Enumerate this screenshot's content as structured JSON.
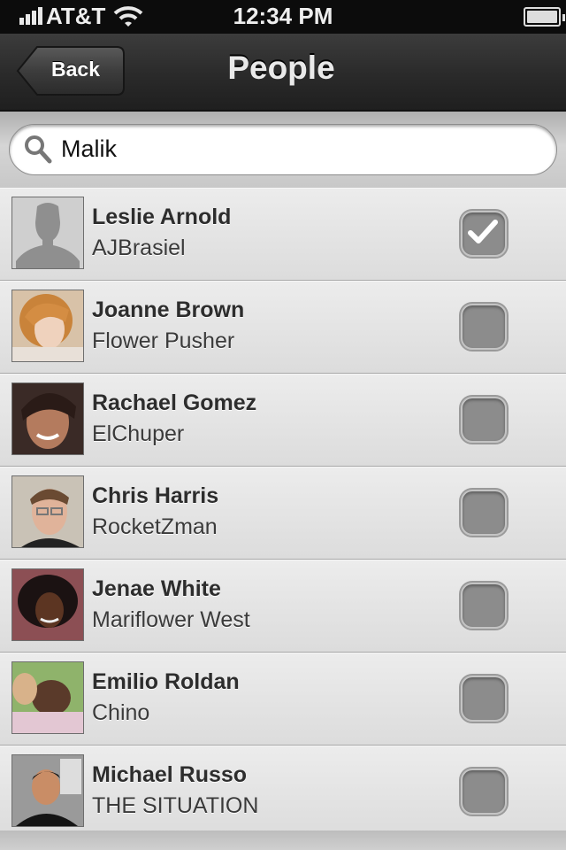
{
  "status_bar": {
    "carrier": "AT&T",
    "time": "12:34 PM"
  },
  "nav": {
    "back_label": "Back",
    "title": "People"
  },
  "search": {
    "value": "Malik"
  },
  "people": [
    {
      "name": "Leslie Arnold",
      "handle": "AJBrasiel",
      "checked": true,
      "avatar": "placeholder"
    },
    {
      "name": "Joanne Brown",
      "handle": "Flower Pusher",
      "checked": false,
      "avatar": "photo"
    },
    {
      "name": "Rachael Gomez",
      "handle": "ElChuper",
      "checked": false,
      "avatar": "photo"
    },
    {
      "name": "Chris Harris",
      "handle": "RocketZman",
      "checked": false,
      "avatar": "photo"
    },
    {
      "name": "Jenae White",
      "handle": "Mariflower West",
      "checked": false,
      "avatar": "photo"
    },
    {
      "name": "Emilio Roldan",
      "handle": "Chino",
      "checked": false,
      "avatar": "photo"
    },
    {
      "name": "Michael Russo",
      "handle": "THE SITUATION",
      "checked": false,
      "avatar": "photo"
    }
  ],
  "colors": {
    "nav_background": "#2a2a2a",
    "list_background": "#e4e4e4",
    "checkbox_fill": "#8c8c8c"
  }
}
